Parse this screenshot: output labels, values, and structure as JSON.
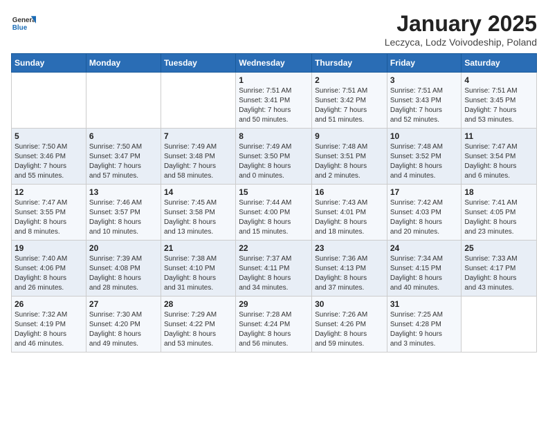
{
  "header": {
    "logo_general": "General",
    "logo_blue": "Blue",
    "title": "January 2025",
    "subtitle": "Leczyca, Lodz Voivodeship, Poland"
  },
  "weekdays": [
    "Sunday",
    "Monday",
    "Tuesday",
    "Wednesday",
    "Thursday",
    "Friday",
    "Saturday"
  ],
  "weeks": [
    [
      {
        "day": "",
        "info": ""
      },
      {
        "day": "",
        "info": ""
      },
      {
        "day": "",
        "info": ""
      },
      {
        "day": "1",
        "info": "Sunrise: 7:51 AM\nSunset: 3:41 PM\nDaylight: 7 hours\nand 50 minutes."
      },
      {
        "day": "2",
        "info": "Sunrise: 7:51 AM\nSunset: 3:42 PM\nDaylight: 7 hours\nand 51 minutes."
      },
      {
        "day": "3",
        "info": "Sunrise: 7:51 AM\nSunset: 3:43 PM\nDaylight: 7 hours\nand 52 minutes."
      },
      {
        "day": "4",
        "info": "Sunrise: 7:51 AM\nSunset: 3:45 PM\nDaylight: 7 hours\nand 53 minutes."
      }
    ],
    [
      {
        "day": "5",
        "info": "Sunrise: 7:50 AM\nSunset: 3:46 PM\nDaylight: 7 hours\nand 55 minutes."
      },
      {
        "day": "6",
        "info": "Sunrise: 7:50 AM\nSunset: 3:47 PM\nDaylight: 7 hours\nand 57 minutes."
      },
      {
        "day": "7",
        "info": "Sunrise: 7:49 AM\nSunset: 3:48 PM\nDaylight: 7 hours\nand 58 minutes."
      },
      {
        "day": "8",
        "info": "Sunrise: 7:49 AM\nSunset: 3:50 PM\nDaylight: 8 hours\nand 0 minutes."
      },
      {
        "day": "9",
        "info": "Sunrise: 7:48 AM\nSunset: 3:51 PM\nDaylight: 8 hours\nand 2 minutes."
      },
      {
        "day": "10",
        "info": "Sunrise: 7:48 AM\nSunset: 3:52 PM\nDaylight: 8 hours\nand 4 minutes."
      },
      {
        "day": "11",
        "info": "Sunrise: 7:47 AM\nSunset: 3:54 PM\nDaylight: 8 hours\nand 6 minutes."
      }
    ],
    [
      {
        "day": "12",
        "info": "Sunrise: 7:47 AM\nSunset: 3:55 PM\nDaylight: 8 hours\nand 8 minutes."
      },
      {
        "day": "13",
        "info": "Sunrise: 7:46 AM\nSunset: 3:57 PM\nDaylight: 8 hours\nand 10 minutes."
      },
      {
        "day": "14",
        "info": "Sunrise: 7:45 AM\nSunset: 3:58 PM\nDaylight: 8 hours\nand 13 minutes."
      },
      {
        "day": "15",
        "info": "Sunrise: 7:44 AM\nSunset: 4:00 PM\nDaylight: 8 hours\nand 15 minutes."
      },
      {
        "day": "16",
        "info": "Sunrise: 7:43 AM\nSunset: 4:01 PM\nDaylight: 8 hours\nand 18 minutes."
      },
      {
        "day": "17",
        "info": "Sunrise: 7:42 AM\nSunset: 4:03 PM\nDaylight: 8 hours\nand 20 minutes."
      },
      {
        "day": "18",
        "info": "Sunrise: 7:41 AM\nSunset: 4:05 PM\nDaylight: 8 hours\nand 23 minutes."
      }
    ],
    [
      {
        "day": "19",
        "info": "Sunrise: 7:40 AM\nSunset: 4:06 PM\nDaylight: 8 hours\nand 26 minutes."
      },
      {
        "day": "20",
        "info": "Sunrise: 7:39 AM\nSunset: 4:08 PM\nDaylight: 8 hours\nand 28 minutes."
      },
      {
        "day": "21",
        "info": "Sunrise: 7:38 AM\nSunset: 4:10 PM\nDaylight: 8 hours\nand 31 minutes."
      },
      {
        "day": "22",
        "info": "Sunrise: 7:37 AM\nSunset: 4:11 PM\nDaylight: 8 hours\nand 34 minutes."
      },
      {
        "day": "23",
        "info": "Sunrise: 7:36 AM\nSunset: 4:13 PM\nDaylight: 8 hours\nand 37 minutes."
      },
      {
        "day": "24",
        "info": "Sunrise: 7:34 AM\nSunset: 4:15 PM\nDaylight: 8 hours\nand 40 minutes."
      },
      {
        "day": "25",
        "info": "Sunrise: 7:33 AM\nSunset: 4:17 PM\nDaylight: 8 hours\nand 43 minutes."
      }
    ],
    [
      {
        "day": "26",
        "info": "Sunrise: 7:32 AM\nSunset: 4:19 PM\nDaylight: 8 hours\nand 46 minutes."
      },
      {
        "day": "27",
        "info": "Sunrise: 7:30 AM\nSunset: 4:20 PM\nDaylight: 8 hours\nand 49 minutes."
      },
      {
        "day": "28",
        "info": "Sunrise: 7:29 AM\nSunset: 4:22 PM\nDaylight: 8 hours\nand 53 minutes."
      },
      {
        "day": "29",
        "info": "Sunrise: 7:28 AM\nSunset: 4:24 PM\nDaylight: 8 hours\nand 56 minutes."
      },
      {
        "day": "30",
        "info": "Sunrise: 7:26 AM\nSunset: 4:26 PM\nDaylight: 8 hours\nand 59 minutes."
      },
      {
        "day": "31",
        "info": "Sunrise: 7:25 AM\nSunset: 4:28 PM\nDaylight: 9 hours\nand 3 minutes."
      },
      {
        "day": "",
        "info": ""
      }
    ]
  ]
}
